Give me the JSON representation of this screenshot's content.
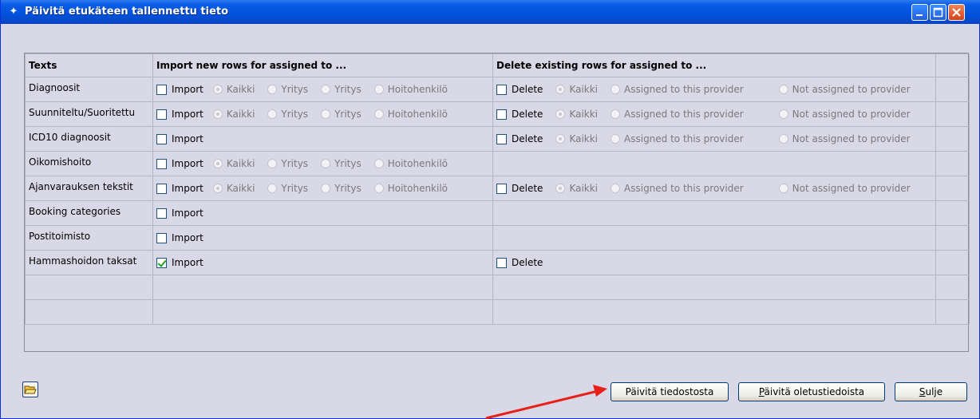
{
  "window": {
    "title": "Päivitä etukäteen tallennettu tieto"
  },
  "table": {
    "headers": [
      "Texts",
      "Import new rows for assigned to ...",
      "Delete existing rows for assigned to ...",
      ""
    ],
    "import_label": "Import",
    "delete_label": "Delete",
    "import_options": [
      "Kaikki",
      "Yritys",
      "Yritys",
      "Hoitohenkilö"
    ],
    "delete_options": [
      "Kaikki",
      "Assigned to this provider",
      "Not assigned to provider"
    ],
    "rows": [
      {
        "label": "Diagnoosit",
        "import": false,
        "import_radios": true,
        "delete": true,
        "delete_radios": true
      },
      {
        "label": "Suunniteltu/Suoritettu",
        "import": false,
        "import_radios": true,
        "delete": true,
        "delete_radios": true
      },
      {
        "label": "ICD10 diagnoosit",
        "import": false,
        "import_radios": false,
        "delete": true,
        "delete_radios": true
      },
      {
        "label": "Oikomishoito",
        "import": false,
        "import_radios": true,
        "delete": false,
        "delete_radios": false
      },
      {
        "label": "Ajanvarauksen tekstit",
        "import": false,
        "import_radios": true,
        "delete": true,
        "delete_radios": true
      },
      {
        "label": "Booking categories",
        "import": false,
        "import_radios": false,
        "delete": false,
        "delete_radios": false
      },
      {
        "label": "Postitoimisto",
        "import": false,
        "import_radios": false,
        "delete": false,
        "delete_radios": false
      },
      {
        "label": "Hammashoidon taksat",
        "import": true,
        "import_radios": false,
        "delete": true,
        "delete_radios": false
      }
    ],
    "empty_rows": 2
  },
  "buttons": {
    "update_from_file": "Päivitä tiedostosta",
    "update_defaults": "Päivitä oletustiedoista",
    "close": "Sulje"
  },
  "annotation": {
    "arrow_color": "#E8201A"
  },
  "colors": {
    "titlebar": "#0052DD",
    "window_bg": "#D9D8E6",
    "check": "#21A121"
  }
}
